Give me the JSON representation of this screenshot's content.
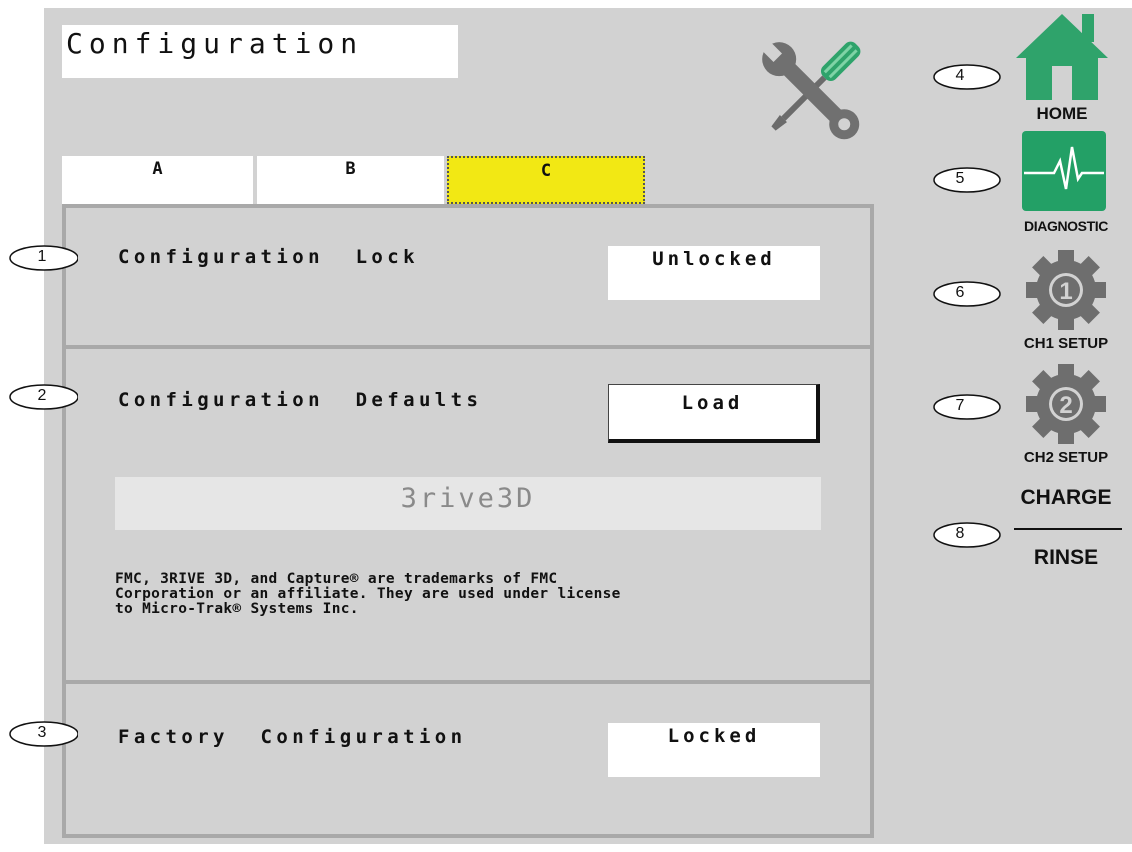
{
  "header": {
    "title": "Configuration",
    "tools_icon": "wrench-screwdriver-icon"
  },
  "tabs": [
    {
      "label": "A",
      "active": false
    },
    {
      "label": "B",
      "active": false
    },
    {
      "label": "C",
      "active": true
    }
  ],
  "rows": {
    "lock": {
      "callout": "1",
      "label": "Configuration  Lock",
      "value": "Unlocked"
    },
    "defaults": {
      "callout": "2",
      "label": "Configuration  Defaults",
      "button": "Load"
    },
    "factory": {
      "callout": "3",
      "label": "Factory  Configuration",
      "value": "Locked"
    }
  },
  "brand": "3rive3D",
  "notice": "FMC, 3RIVE 3D, and Capture® are trademarks of FMC\nCorporation or an affiliate. They are used under license\nto Micro-Trak® Systems Inc.",
  "sidebar": {
    "home": {
      "callout": "4",
      "label": "HOME",
      "icon": "home-icon",
      "color": "#2fa36b"
    },
    "diagnostic": {
      "callout": "5",
      "label": "DIAGNOSTIC",
      "icon": "heartbeat-icon",
      "color": "#23a066"
    },
    "ch1": {
      "callout": "6",
      "label": "CH1 SETUP",
      "icon": "gear-1-icon"
    },
    "ch2": {
      "callout": "7",
      "label": "CH2 SETUP",
      "icon": "gear-2-icon"
    },
    "charge_rinse": {
      "callout": "8",
      "top": "CHARGE",
      "bottom": "RINSE"
    }
  },
  "colors": {
    "active_tab": "#f2e814",
    "panel": "#d2d2d2",
    "border": "#a9a9a9"
  }
}
